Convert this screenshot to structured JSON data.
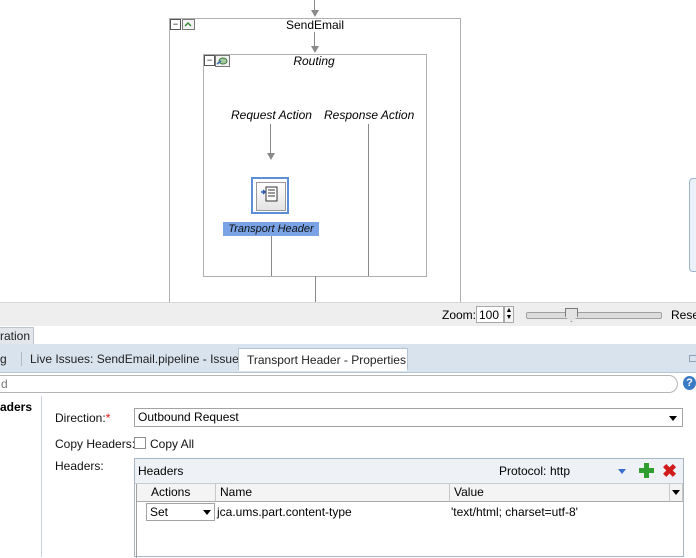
{
  "canvas": {
    "stage_title": "SendEmail",
    "routing_title": "Routing",
    "request_action": "Request Action",
    "response_action": "Response Action",
    "action_node_label": "Transport Header"
  },
  "zoom": {
    "label": "Zoom:",
    "value": "100",
    "reset_label": "Rese",
    "level_percent": 100
  },
  "panel_tabs": {
    "left_partial": "ration",
    "tabs": [
      {
        "label": "g",
        "active": false
      },
      {
        "label": "Live Issues: SendEmail.pipeline - Issues",
        "active": false
      },
      {
        "label": "Transport Header - Properties",
        "active": true,
        "close": "×"
      }
    ]
  },
  "search": {
    "partial_text": "d"
  },
  "help": {
    "glyph": "?"
  },
  "properties": {
    "section_partial": "aders",
    "direction_label": "Direction:",
    "required_mark": "*",
    "direction_value": "Outbound Request",
    "copy_headers_label": "Copy Headers:",
    "copy_all_label": "Copy All",
    "copy_all_checked": false,
    "headers_label": "Headers:",
    "headers_panel": {
      "title": "Headers",
      "protocol_label": "Protocol:",
      "protocol_value": "http",
      "add_icon": "plus-icon",
      "remove_icon": "x-icon",
      "columns": [
        "Actions",
        "Name",
        "Value"
      ],
      "rows": [
        {
          "action": "Set",
          "name": "jca.ums.part.content-type",
          "value": "'text/html; charset=utf-8'"
        }
      ]
    }
  }
}
